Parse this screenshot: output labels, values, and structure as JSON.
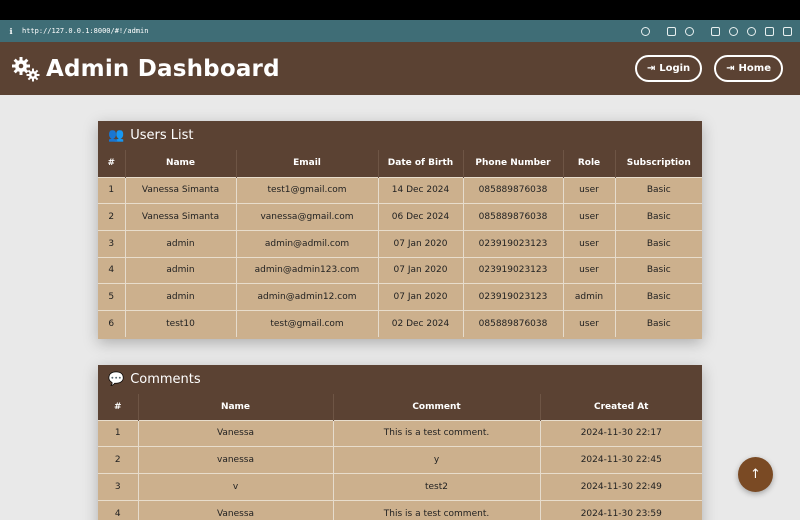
{
  "browser": {
    "url": "http://127.0.0.1:8000/#!/admin",
    "info_icon": "info-icon"
  },
  "header": {
    "title": "Admin Dashboard",
    "icon": "gears-icon",
    "login_label": "Login",
    "home_label": "Home"
  },
  "users": {
    "title": "Users List",
    "columns": [
      "#",
      "Name",
      "Email",
      "Date of Birth",
      "Phone Number",
      "Role",
      "Subscription"
    ],
    "rows": [
      [
        "1",
        "Vanessa Simanta",
        "test1@gmail.com",
        "14 Dec 2024",
        "085889876038",
        "user",
        "Basic"
      ],
      [
        "2",
        "Vanessa Simanta",
        "vanessa@gmail.com",
        "06 Dec 2024",
        "085889876038",
        "user",
        "Basic"
      ],
      [
        "3",
        "admin",
        "admin@admil.com",
        "07 Jan 2020",
        "023919023123",
        "user",
        "Basic"
      ],
      [
        "4",
        "admin",
        "admin@admin123.com",
        "07 Jan 2020",
        "023919023123",
        "user",
        "Basic"
      ],
      [
        "5",
        "admin",
        "admin@admin12.com",
        "07 Jan 2020",
        "023919023123",
        "admin",
        "Basic"
      ],
      [
        "6",
        "test10",
        "test@gmail.com",
        "02 Dec 2024",
        "085889876038",
        "user",
        "Basic"
      ]
    ]
  },
  "comments": {
    "title": "Comments",
    "columns": [
      "#",
      "Name",
      "Comment",
      "Created At"
    ],
    "rows": [
      [
        "1",
        "Vanessa",
        "This is a test comment.",
        "2024-11-30 22:17"
      ],
      [
        "2",
        "vanessa",
        "y",
        "2024-11-30 22:45"
      ],
      [
        "3",
        "v",
        "test2",
        "2024-11-30 22:49"
      ],
      [
        "4",
        "Vanessa",
        "This is a test comment.",
        "2024-11-30 23:59"
      ]
    ]
  },
  "colors": {
    "header_bg": "#5b4233",
    "table_body_bg": "#ccb08d",
    "page_bg": "#e9e9e9",
    "browser_bar": "#3f6d76",
    "scroll_top_bg": "#7a4a24"
  }
}
